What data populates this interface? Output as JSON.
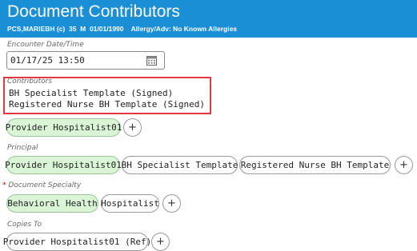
{
  "header": {
    "title": "Document Contributors",
    "patient_info": "PCS,MARIEBH (c)  35  M  01/01/1990    Allergy/Adv: No Known Allergies"
  },
  "encounter": {
    "label": "Encounter Date/Time",
    "value": "01/17/25 13:50"
  },
  "contributors": {
    "label": "Contributors",
    "items": [
      "BH Specialist Template (Signed)",
      "Registered Nurse BH Template (Signed)"
    ]
  },
  "authors": {
    "chips": [
      "Provider Hospitalist01"
    ],
    "add_label": "+"
  },
  "principal": {
    "label": "Principal",
    "chips": [
      "Provider Hospitalist01",
      "BH Specialist Template",
      "Registered Nurse BH Template"
    ],
    "add_label": "+"
  },
  "document_specialty": {
    "required_mark": "*",
    "label": "Document Specialty",
    "chips": [
      "Behavioral Health",
      "Hospitalist"
    ],
    "add_label": "+"
  },
  "copies_to": {
    "label": "Copies To",
    "chips": [
      "Provider Hospitalist01 (Ref)"
    ],
    "add_label": "+"
  },
  "colors": {
    "header_bg": "#1a8fd6",
    "chip_selected_bg": "#daf5d6",
    "highlight_border": "#e0393e"
  },
  "icons": {
    "calendar": "calendar-icon"
  }
}
